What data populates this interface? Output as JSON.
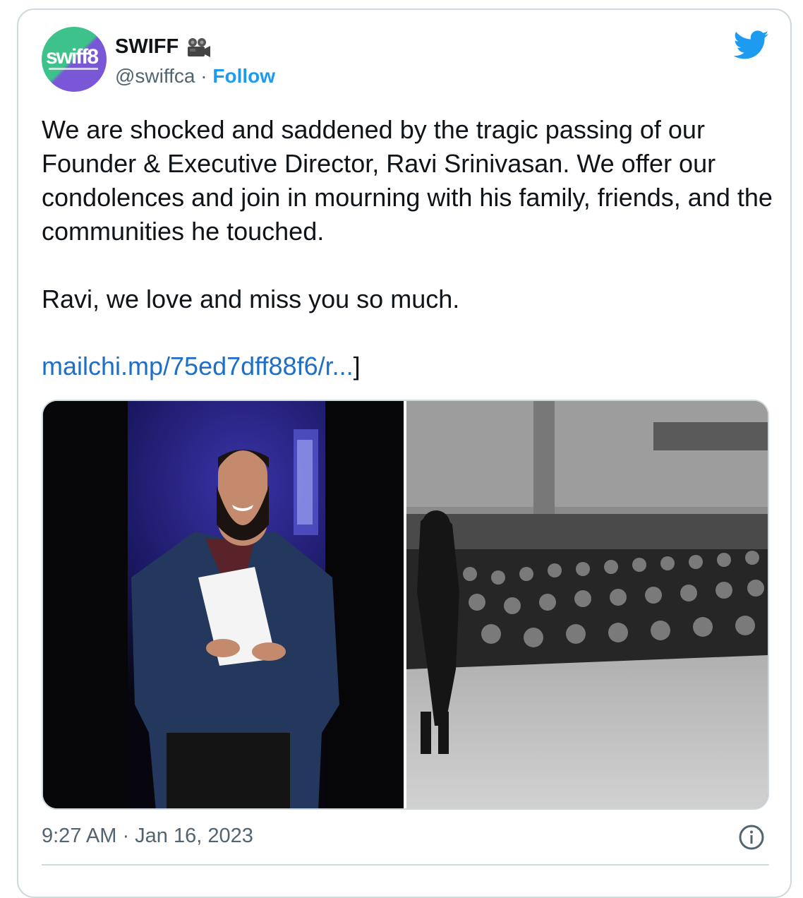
{
  "account": {
    "avatar_text": "swiff8",
    "display_name": "SWIFF",
    "handle": "@swiffca",
    "separator": " · ",
    "follow_label": "Follow"
  },
  "icons": {
    "brand": "twitter-bird-icon",
    "name_emoji": "movie-camera-icon",
    "info": "info-icon"
  },
  "tweet": {
    "text": "We are shocked and saddened by the tragic passing of our Founder & Executive Director, Ravi Srinivasan. We offer our condolences and join in mourning with his family, friends, and the communities he touched.\n\nRavi, we love and miss you so much.",
    "link_text": "mailchi.mp/75ed7dff88f6/r...",
    "link_suffix": "]"
  },
  "media": [
    {
      "description": "photo-man-in-blue-blazer-holding-papers-on-stage"
    },
    {
      "description": "photo-black-and-white-speaker-addressing-theater-audience"
    }
  ],
  "meta": {
    "timestamp": "9:27 AM · Jan 16, 2023"
  },
  "colors": {
    "link": "#1d9bf0",
    "text": "#0f1419",
    "secondary": "#536471",
    "border": "#cfd9de"
  }
}
